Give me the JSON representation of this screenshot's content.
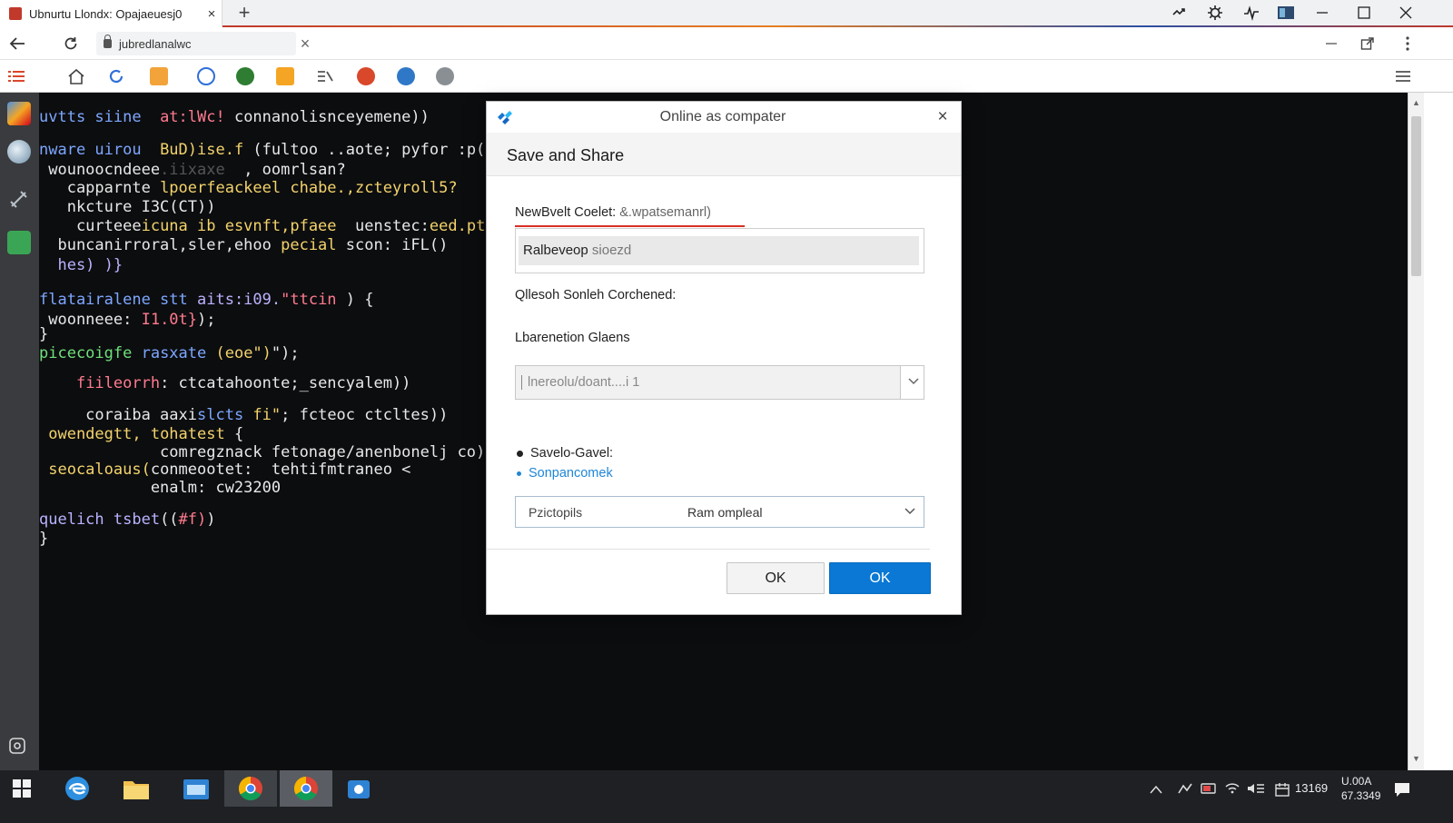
{
  "browser": {
    "tab_title": "Ubnurtu Llondx: Opajaeuesj0",
    "url": "jubredlanalwc",
    "new_tab_symbol": "+",
    "close_symbol": "×"
  },
  "editor": {
    "lines": [
      {
        "segments": [
          {
            "t": "uvtts siine  ",
            "c": "#7da7ff"
          },
          {
            "t": "at:lWc! ",
            "c": "#ff7b8f"
          },
          {
            "t": "connanolisnceyemene))",
            "c": "#e8e8e8"
          }
        ]
      },
      {
        "segments": [
          {
            "t": "nware uirou  ",
            "c": "#7da7ff"
          },
          {
            "t": "BuD)ise.f ",
            "c": "#f3d36b"
          },
          {
            "t": "(fultoo ..aote; pyfor :p(;s",
            "c": "#e8e8e8"
          }
        ]
      },
      {
        "segments": [
          {
            "t": " wounoocndeee",
            "c": "#e8e8e8"
          },
          {
            "t": ".iixaxe ",
            "c": "#555555"
          },
          {
            "t": " , oomrlsan?",
            "c": "#e8e8e8"
          }
        ]
      },
      {
        "segments": [
          {
            "t": "   capparnte ",
            "c": "#e8e8e8"
          },
          {
            "t": "lpoerfeackeel ",
            "c": "#f3d36b"
          },
          {
            "t": "chabe.,zcteyroll5?",
            "c": "#f3d36b"
          }
        ]
      },
      {
        "segments": [
          {
            "t": "   nkcture I3C(CT))",
            "c": "#e8e8e8"
          }
        ]
      },
      {
        "segments": [
          {
            "t": "    curteee",
            "c": "#e8e8e8"
          },
          {
            "t": "icuna ib esvnft,pfaee ",
            "c": "#f3d36b"
          },
          {
            "t": " uenstec:",
            "c": "#e8e8e8"
          },
          {
            "t": "eed.ptd)",
            "c": "#f3d36b"
          }
        ]
      },
      {
        "segments": [
          {
            "t": "  buncanirroral,sler,ehoo ",
            "c": "#e8e8e8"
          },
          {
            "t": "pecial ",
            "c": "#f3d36b"
          },
          {
            "t": "scon: iFL()",
            "c": "#e8e8e8"
          }
        ]
      },
      {
        "segments": [
          {
            "t": "  hes) )}",
            "c": "#b9b3ff"
          }
        ]
      },
      {
        "segments": [
          {
            "t": "flatairalene stt ",
            "c": "#7da7ff"
          },
          {
            "t": "aits:i09.",
            "c": "#b9b3ff"
          },
          {
            "t": "\"ttcin",
            "c": "#ff7b8f"
          },
          {
            "t": " ) {",
            "c": "#e8e8e8"
          }
        ]
      },
      {
        "segments": [
          {
            "t": " woonneee: ",
            "c": "#e8e8e8"
          },
          {
            "t": "I1.0t}",
            "c": "#ff7b8f"
          },
          {
            "t": ");",
            "c": "#e8e8e8"
          }
        ]
      },
      {
        "segments": [
          {
            "t": "}",
            "c": "#e8e8e8"
          }
        ]
      },
      {
        "segments": [
          {
            "t": "picecoigfe ",
            "c": "#6fe07a"
          },
          {
            "t": "rasxate ",
            "c": "#7da7ff"
          },
          {
            "t": "(eoe\")",
            "c": "#f3d36b"
          },
          {
            "t": "\");",
            "c": "#e8e8e8"
          }
        ]
      },
      {
        "segments": [
          {
            "t": "    ",
            "c": "#e8e8e8"
          },
          {
            "t": "fiileorrh",
            "c": "#ff7b8f"
          },
          {
            "t": ": ctcatahoonte;_sencyalem))",
            "c": "#e8e8e8"
          }
        ]
      },
      {
        "segments": [
          {
            "t": "     coraiba aaxi",
            "c": "#e8e8e8"
          },
          {
            "t": "slcts ",
            "c": "#7da7ff"
          },
          {
            "t": "fi\"",
            "c": "#f3d36b"
          },
          {
            "t": "; fcteoc ctcltes))",
            "c": "#e8e8e8"
          }
        ]
      },
      {
        "segments": [
          {
            "t": " owendegtt, ",
            "c": "#f3d36b"
          },
          {
            "t": "tohatest",
            "c": "#f3d36b"
          },
          {
            "t": " {",
            "c": "#e8e8e8"
          }
        ]
      },
      {
        "segments": [
          {
            "t": "             comregznack fetonage/anenbonelj co)f(",
            "c": "#e8e8e8"
          }
        ]
      },
      {
        "segments": [
          {
            "t": " seocaloaus(",
            "c": "#f3d36b"
          },
          {
            "t": "conmeootet:  tehtifmtraneo <",
            "c": "#e8e8e8"
          }
        ]
      },
      {
        "segments": [
          {
            "t": "            enalm: cw23200",
            "c": "#e8e8e8"
          }
        ]
      },
      {
        "segments": [
          {
            "t": "quelich tsbet",
            "c": "#b9b3ff"
          },
          {
            "t": "((",
            "c": "#e8e8e8"
          },
          {
            "t": "#f)",
            "c": "#ff7b8f"
          },
          {
            "t": ")",
            "c": "#e8e8e8"
          }
        ]
      },
      {
        "segments": [
          {
            "t": "}",
            "c": "#e8e8e8"
          }
        ]
      }
    ]
  },
  "dialog": {
    "title": "Online as compater",
    "close_symbol": "×",
    "header": "Save and Share",
    "field1_label": "NewBvelt Coelet:",
    "field1_label_hint": "&.wpatsemanrl)",
    "field1_value": "Ralbeveop",
    "field1_value_hint": "sioezd",
    "section_label": "Qllesoh Sonleh Corchened:",
    "field2_label": "Lbarenetion Glaens",
    "select1_value": "lnereolu/doant....i 1",
    "radio1_label": "Savelo-Gavel:",
    "radio2_label": "Sonpancomek",
    "select2_left": "Pzictopils",
    "select2_value": "Ram ompleal",
    "cancel_label": "OK",
    "ok_label": "OK"
  },
  "taskbar": {
    "tray_time": "13169",
    "date_line1": "U.00A",
    "date_line2": "67.3349"
  },
  "colors": {
    "accent": "#0a78d4",
    "editor_bg": "#0c0d0f",
    "dock_bg": "#3a3b3e",
    "taskbar_bg": "#1e2024"
  }
}
